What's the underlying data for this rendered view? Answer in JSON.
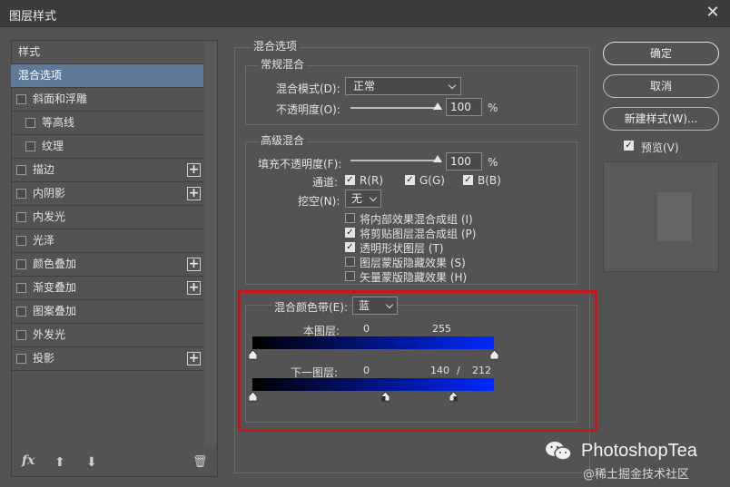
{
  "dialog": {
    "title": "图层样式",
    "close_glyph": "✕"
  },
  "left": {
    "items": [
      {
        "label": "样式",
        "kind": "plain"
      },
      {
        "label": "混合选项",
        "kind": "selected"
      },
      {
        "label": "斜面和浮雕",
        "kind": "check"
      },
      {
        "label": "等高线",
        "kind": "sub"
      },
      {
        "label": "纹理",
        "kind": "sub"
      },
      {
        "label": "描边",
        "kind": "check",
        "plus": "+"
      },
      {
        "label": "内阴影",
        "kind": "check",
        "plus": "+"
      },
      {
        "label": "内发光",
        "kind": "check"
      },
      {
        "label": "光泽",
        "kind": "check"
      },
      {
        "label": "颜色叠加",
        "kind": "check",
        "plus": "+"
      },
      {
        "label": "渐变叠加",
        "kind": "check",
        "plus": "+"
      },
      {
        "label": "图案叠加",
        "kind": "check"
      },
      {
        "label": "外发光",
        "kind": "check"
      },
      {
        "label": "投影",
        "kind": "check",
        "plus": "+"
      }
    ],
    "bottom": {
      "fx": "fx",
      "up": "⬆",
      "down": "⬇",
      "trash": "🗑"
    }
  },
  "blend": {
    "section_title": "混合选项",
    "general": {
      "title": "常规混合",
      "mode_label": "混合模式(D):",
      "mode_value": "正常",
      "opacity_label": "不透明度(O):",
      "opacity_value": "100",
      "opacity_unit": "%"
    },
    "advanced": {
      "title": "高级混合",
      "fill_label": "填充不透明度(F):",
      "fill_value": "100",
      "fill_unit": "%",
      "channels_label": "通道:",
      "channel_r": "R(R)",
      "channel_g": "G(G)",
      "channel_b": "B(B)",
      "knockout_label": "挖空(N):",
      "knockout_value": "无",
      "options": [
        {
          "label": "将内部效果混合成组 (I)",
          "checked": false
        },
        {
          "label": "将剪贴图层混合成组 (P)",
          "checked": true
        },
        {
          "label": "透明形状图层 (T)",
          "checked": true
        },
        {
          "label": "图层蒙版隐藏效果 (S)",
          "checked": false
        },
        {
          "label": "矢量蒙版隐藏效果 (H)",
          "checked": false
        }
      ]
    },
    "band": {
      "label": "混合颜色带(E):",
      "value": "蓝",
      "this_layer_label": "本图层:",
      "this_layer_min": "0",
      "this_layer_max": "255",
      "under_layer_label": "下一图层:",
      "under_layer_min": "0",
      "under_layer_mid": "140",
      "under_layer_sep": "/",
      "under_layer_max": "212",
      "this_layer_range": [
        0,
        255
      ],
      "under_layer_range": [
        0,
        140,
        212,
        255
      ]
    }
  },
  "buttons": {
    "ok": "确定",
    "cancel": "取消",
    "new_style": "新建样式(W)...",
    "preview": "预览(V)"
  },
  "watermark": {
    "brand": "PhotoshopTea",
    "credit": "@稀土掘金技术社区"
  },
  "colors": {
    "accent_selected": "#5f7999",
    "highlight_frame": "#c8171b",
    "band_blue": "#0028ff"
  }
}
